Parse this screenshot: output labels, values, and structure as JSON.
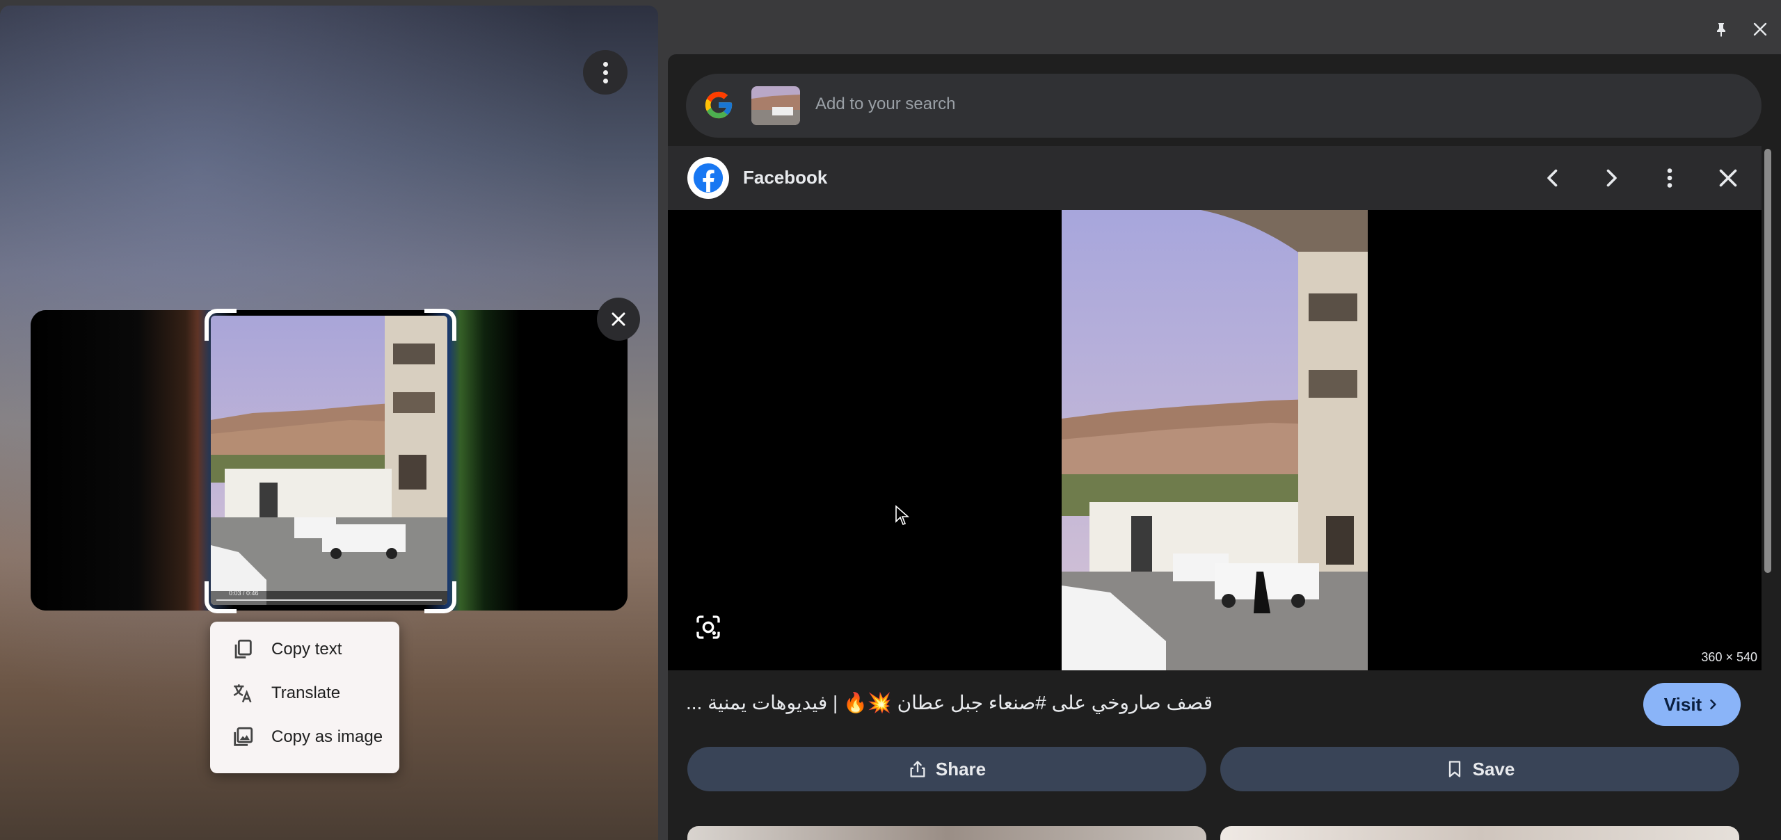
{
  "left_panel": {
    "context_menu": {
      "items": [
        {
          "label": "Copy text",
          "icon": "copy-icon"
        },
        {
          "label": "Translate",
          "icon": "translate-icon"
        },
        {
          "label": "Copy as image",
          "icon": "image-icon"
        }
      ]
    },
    "video_player": {
      "time": "0:03 / 0:46"
    }
  },
  "right_panel": {
    "search": {
      "placeholder": "Add to your search"
    },
    "source": {
      "name": "Facebook"
    },
    "image": {
      "dimensions": "360 × 540"
    },
    "result_title": "قصف صاروخي على #صنعاء جبل عطان 💥🔥 | فيديوهات يمنية ...",
    "visit_label": "Visit",
    "share_label": "Share",
    "save_label": "Save"
  },
  "colors": {
    "accent": "#8ab4f8",
    "button_bg": "#394457",
    "panel_bg": "#1f1f1f"
  }
}
